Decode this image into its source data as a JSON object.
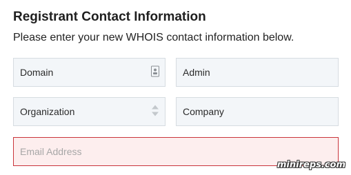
{
  "form": {
    "title": "Registrant Contact Information",
    "subtitle": "Please enter your new WHOIS contact information below.",
    "fields": {
      "domain": {
        "value": "Domain",
        "icon": "contact-card-icon"
      },
      "admin": {
        "value": "Admin"
      },
      "organization": {
        "value": "Organization",
        "icon": "up-down-stepper-icon"
      },
      "company": {
        "value": "Company"
      },
      "email": {
        "placeholder": "Email Address"
      }
    }
  },
  "watermark": "minireps.com",
  "colors": {
    "field_bg": "#f3f6f9",
    "field_border": "#d6dce1",
    "error_border": "#c9333a",
    "error_bg": "#fdeeee"
  }
}
